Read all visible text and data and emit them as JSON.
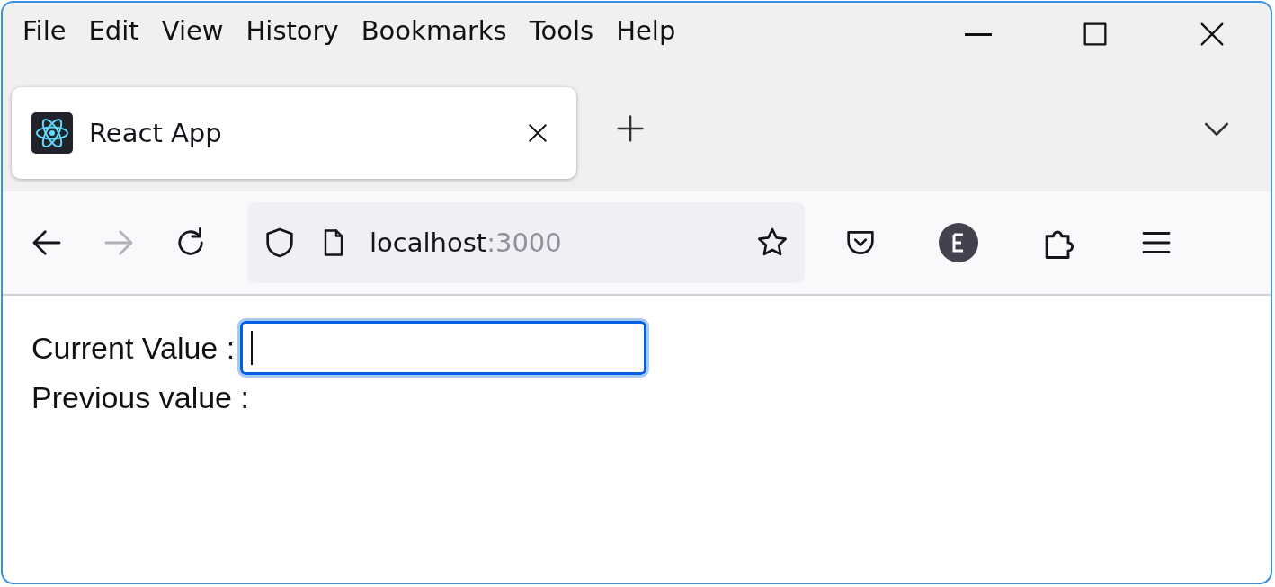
{
  "menu": [
    "File",
    "Edit",
    "View",
    "History",
    "Bookmarks",
    "Tools",
    "Help"
  ],
  "tabs": [
    {
      "title": "React App",
      "selected": true
    }
  ],
  "toolbar": {
    "back_disabled": false,
    "forward_disabled": true,
    "address": {
      "host": "localhost",
      "port": ":3000"
    }
  },
  "content": {
    "rows": [
      {
        "kind": "input",
        "label": "Current Value :",
        "focused": true
      },
      {
        "kind": "text",
        "label": "Previous value :"
      }
    ]
  }
}
